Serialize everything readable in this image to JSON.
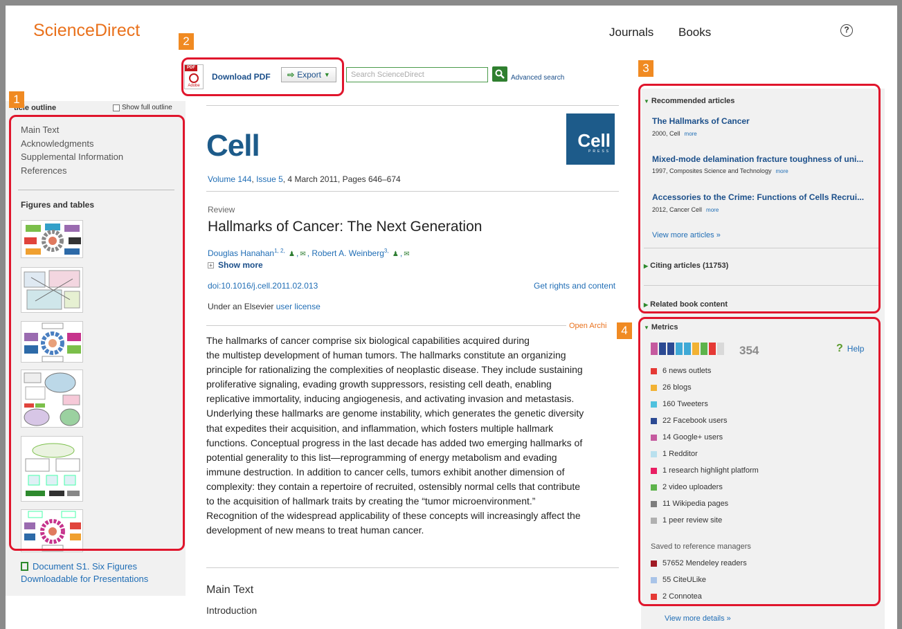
{
  "header": {
    "logo": "ScienceDirect",
    "nav": [
      "Journals",
      "Books"
    ],
    "help_symbol": "?"
  },
  "outline": {
    "title": "Article outline",
    "title_visible": "ticle outline",
    "show_full_label": "Show full outline",
    "items": [
      "Main Text",
      "Acknowledgments",
      "Supplemental Information",
      "References"
    ],
    "figures_title": "Figures and tables",
    "doc_link_line1": "Document S1. Six Figures",
    "doc_link_line2": "Downloadable for Presentations"
  },
  "toolbar": {
    "pdf_label": "Download PDF",
    "export_label": "Export",
    "search_placeholder": "Search ScienceDirect",
    "advanced_search": "Advanced search"
  },
  "article": {
    "journal": "Cell",
    "press_logo_main": "Cell",
    "press_logo_sub": "PRESS",
    "volume": "Volume 144",
    "issue": "Issue 5",
    "date_pages": ", 4 March 2011, Pages 646–674",
    "type": "Review",
    "title": "Hallmarks of Cancer: The Next Generation",
    "author1": "Douglas Hanahan",
    "author1_sup": "1, 2,",
    "author2": "Robert A. Weinberg",
    "author2_sup": "3,",
    "show_more": "Show more",
    "doi": "doi:10.1016/j.cell.2011.02.013",
    "rights": "Get rights and content",
    "license_prefix": "Under an Elsevier ",
    "license_link": "user license",
    "open_archive": "Open Archi",
    "abstract_lines": [
      "The hallmarks of cancer comprise six biological capabilities acquired during",
      "the multistep development of human tumors. The hallmarks constitute an organizing",
      "principle for rationalizing the complexities of neoplastic disease. They include sustaining",
      "proliferative signaling, evading growth suppressors, resisting cell death, enabling",
      "replicative immortality, inducing angiogenesis, and activating invasion and metastasis.",
      "Underlying these hallmarks are genome instability, which generates the genetic diversity",
      "that expedites their acquisition, and inflammation, which fosters multiple hallmark",
      "functions. Conceptual progress in the last decade has added two emerging hallmarks of",
      "potential generality to this list—reprogramming of energy metabolism and evading",
      "immune destruction. In addition to cancer cells, tumors exhibit another dimension of",
      "complexity: they contain a repertoire of recruited, ostensibly normal cells that contribute",
      "to the acquisition of hallmark traits by creating the “tumor microenvironment.”",
      "Recognition of the widespread applicability of these concepts will increasingly affect the",
      "development of new means to treat human cancer."
    ],
    "section_heading": "Main Text",
    "subsection": "Introduction"
  },
  "recommended": {
    "heading": "Recommended articles",
    "items": [
      {
        "title": "The Hallmarks of Cancer",
        "meta": "2000, Cell",
        "more": "more"
      },
      {
        "title": "Mixed-mode delamination fracture toughness of uni...",
        "meta": "1997, Composites Science and Technology",
        "more": "more"
      },
      {
        "title": "Accessories to the Crime: Functions of Cells Recrui...",
        "meta": "2012, Cancer Cell",
        "more": "more"
      }
    ],
    "view_more": "View more articles »",
    "citing": "Citing articles (11753)",
    "related": "Related book content"
  },
  "metrics": {
    "heading": "Metrics",
    "score": "354",
    "help": "Help",
    "bar_colors": [
      "#c55a9f",
      "#2c4a93",
      "#2c4a93",
      "#3fa9d6",
      "#3fa9d6",
      "#f2b233",
      "#5db34b",
      "#e53935",
      "#d9d9d9"
    ],
    "items": [
      {
        "label": "6 news outlets",
        "color": "#e53935"
      },
      {
        "label": "26 blogs",
        "color": "#f2b233"
      },
      {
        "label": "160 Tweeters",
        "color": "#4fc1de"
      },
      {
        "label": "22 Facebook users",
        "color": "#2c4a93"
      },
      {
        "label": "14 Google+ users",
        "color": "#c55a9f"
      },
      {
        "label": "1 Redditor",
        "color": "#b9e0ee"
      },
      {
        "label": "1 research highlight platform",
        "color": "#e91e63"
      },
      {
        "label": "2 video uploaders",
        "color": "#5db34b"
      },
      {
        "label": "11 Wikipedia pages",
        "color": "#7d7d7d"
      },
      {
        "label": "1 peer review site",
        "color": "#b0b0b0"
      }
    ],
    "saved_heading": "Saved to reference managers",
    "saved": [
      {
        "label": "57652 Mendeley readers",
        "color": "#a01a24"
      },
      {
        "label": "55 CiteULike",
        "color": "#a9c4e8"
      },
      {
        "label": "2 Connotea",
        "color": "#e53935"
      }
    ],
    "view_details": "View more details »"
  },
  "annotations": [
    "1",
    "2",
    "3",
    "4"
  ]
}
